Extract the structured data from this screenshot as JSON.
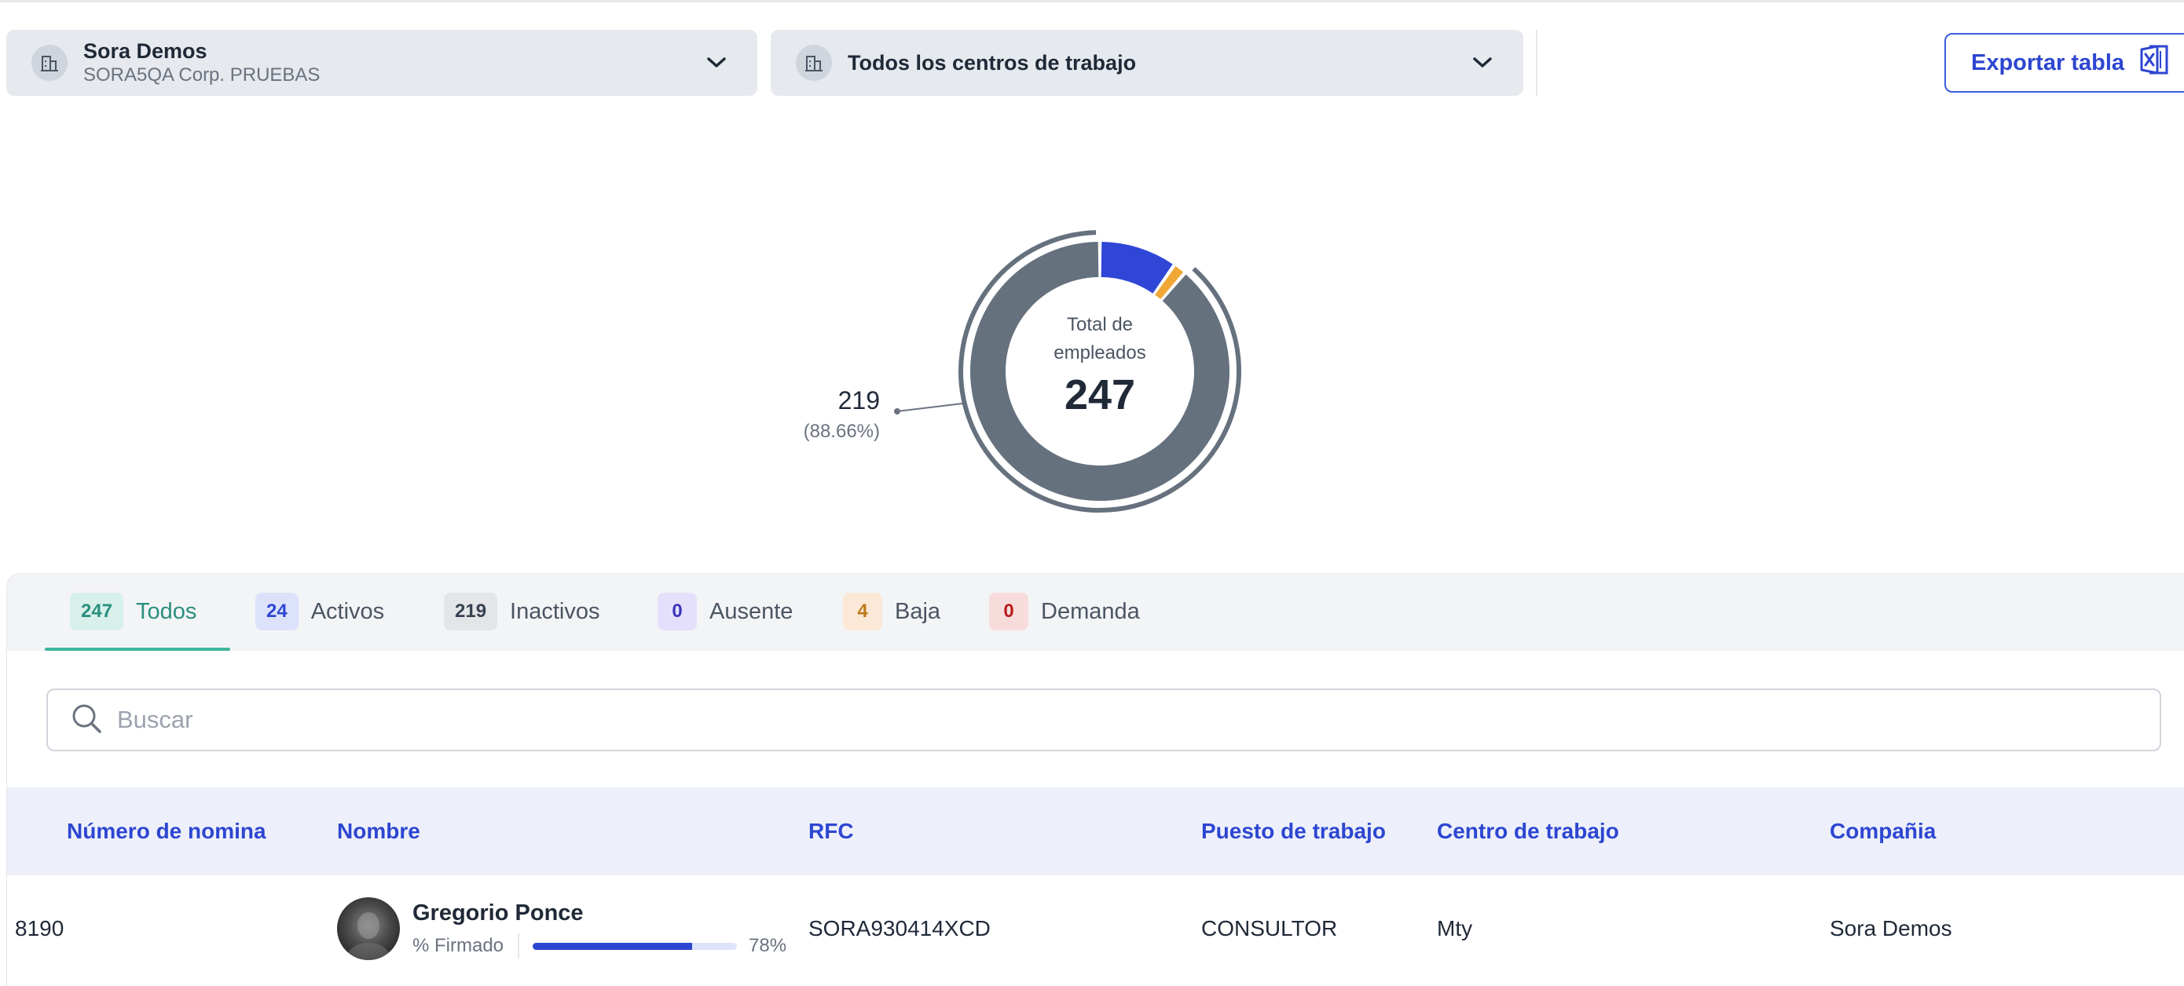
{
  "filters": {
    "company": {
      "name": "Sora Demos",
      "subtitle": "SORA5QA Corp. PRUEBAS",
      "icon": "building-icon"
    },
    "work_center": {
      "name": "Todos los centros de trabajo",
      "icon": "building-icon"
    }
  },
  "export": {
    "label": "Exportar tabla",
    "icon": "excel-icon"
  },
  "chart_data": {
    "type": "pie",
    "title": "",
    "center_label": "Total de empleados",
    "total": 247,
    "categories": [
      "Activos",
      "Inactivos",
      "Baja",
      "Ausente",
      "Demanda"
    ],
    "values": [
      24,
      219,
      4,
      0,
      0
    ],
    "colors": [
      "#2f46d6",
      "#66717e",
      "#f0a736",
      "#8b5cf6",
      "#dc2626"
    ],
    "callout": {
      "value": "219",
      "percent": "(88.66%)"
    }
  },
  "tabs": [
    {
      "count": "247",
      "label": "Todos",
      "badge_bg": "#d8f0ea",
      "badge_fg": "#2a8f7e",
      "active": true
    },
    {
      "count": "24",
      "label": "Activos",
      "badge_bg": "#dde2fb",
      "badge_fg": "#2d46d1"
    },
    {
      "count": "219",
      "label": "Inactivos",
      "badge_bg": "#e3e5e8",
      "badge_fg": "#374151"
    },
    {
      "count": "0",
      "label": "Ausente",
      "badge_bg": "#e4e0fb",
      "badge_fg": "#3b35b8"
    },
    {
      "count": "4",
      "label": "Baja",
      "badge_bg": "#fbe8d6",
      "badge_fg": "#c07a1c"
    },
    {
      "count": "0",
      "label": "Demanda",
      "badge_bg": "#f8dcdc",
      "badge_fg": "#b91c1c"
    }
  ],
  "search": {
    "placeholder": "Buscar",
    "value": ""
  },
  "table": {
    "columns": [
      "Número de nomina",
      "Nombre",
      "RFC",
      "Puesto de trabajo",
      "Centro de trabajo",
      "Compañia"
    ],
    "rows": [
      {
        "payroll": "8190",
        "name": "Gregorio Ponce",
        "signed_label": "% Firmado",
        "signed_percent": 78,
        "signed_text": "78%",
        "rfc": "SORA930414XCD",
        "position": "CONSULTOR",
        "center": "Mty",
        "company": "Sora Demos"
      }
    ]
  }
}
